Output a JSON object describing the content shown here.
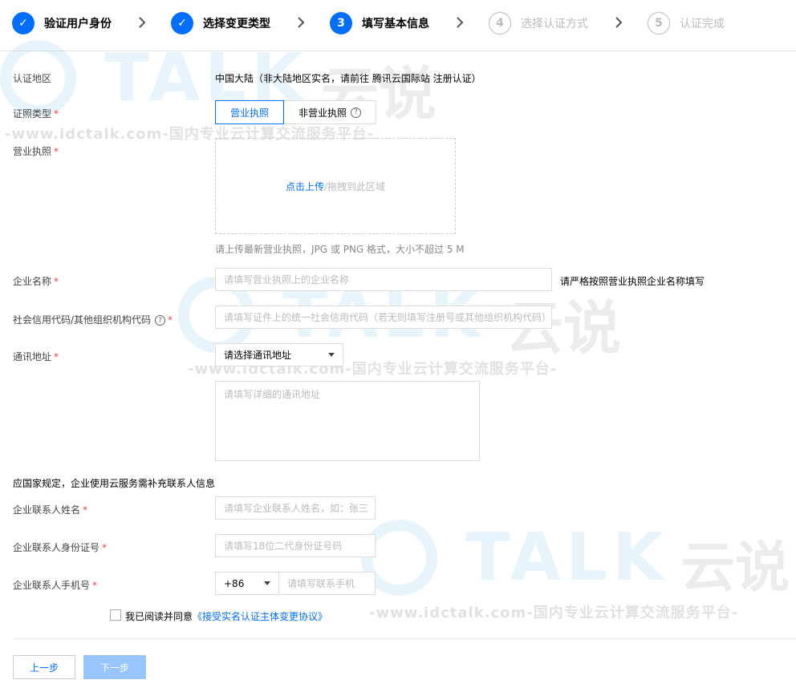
{
  "steps": [
    {
      "label": "验证用户身份",
      "status": "done",
      "marker": "✓"
    },
    {
      "label": "选择变更类型",
      "status": "done",
      "marker": "✓"
    },
    {
      "label": "填写基本信息",
      "status": "active",
      "marker": "3"
    },
    {
      "label": "选择认证方式",
      "status": "todo",
      "marker": "4"
    },
    {
      "label": "认证完成",
      "status": "todo",
      "marker": "5"
    }
  ],
  "watermark": {
    "logo": "TALK",
    "cn": "云说",
    "url": "-www.idctalk.com-国内专业云计算交流服务平台-"
  },
  "form": {
    "region": {
      "label": "认证地区",
      "value": "中国大陆（非大陆地区实名，请前往 腾讯云国际站 注册认证）"
    },
    "cert_type": {
      "label": "证照类型",
      "options": [
        "营业执照",
        "非营业执照"
      ],
      "selected": "营业执照"
    },
    "license": {
      "label": "营业执照",
      "upload_link": "点击上传",
      "upload_hint": "/拖拽到此区域",
      "note": "请上传最新营业执照，JPG 或 PNG 格式，大小不超过 5 M"
    },
    "company_name": {
      "label": "企业名称",
      "placeholder": "请填写营业执照上的企业名称",
      "tip": "请严格按照营业执照企业名称填写"
    },
    "credit_code": {
      "label": "社会信用代码/其他组织机构代码",
      "placeholder": "请填写证件上的统一社会信用代码（若无则填写注册号或其他组织机构代码）"
    },
    "address": {
      "label": "通讯地址",
      "select_value": "请选择通讯地址",
      "detail_placeholder": "请填写详细的通讯地址"
    },
    "contact_notice": "应国家规定，企业使用云服务需补充联系人信息",
    "contact_name": {
      "label": "企业联系人姓名",
      "placeholder": "请填写企业联系人姓名，如：张三"
    },
    "contact_id": {
      "label": "企业联系人身份证号",
      "placeholder": "请填写18位二代身份证号码"
    },
    "contact_phone": {
      "label": "企业联系人手机号",
      "country_code": "+86",
      "placeholder": "请填写联系手机"
    },
    "agreement": {
      "text": "我已阅读并同意",
      "link": "《接受实名认证主体变更协议》"
    }
  },
  "buttons": {
    "prev": "上一步",
    "next": "下一步"
  },
  "colors": {
    "primary": "#006eff",
    "required": "#e54545",
    "disabled": "#99c5ff"
  }
}
